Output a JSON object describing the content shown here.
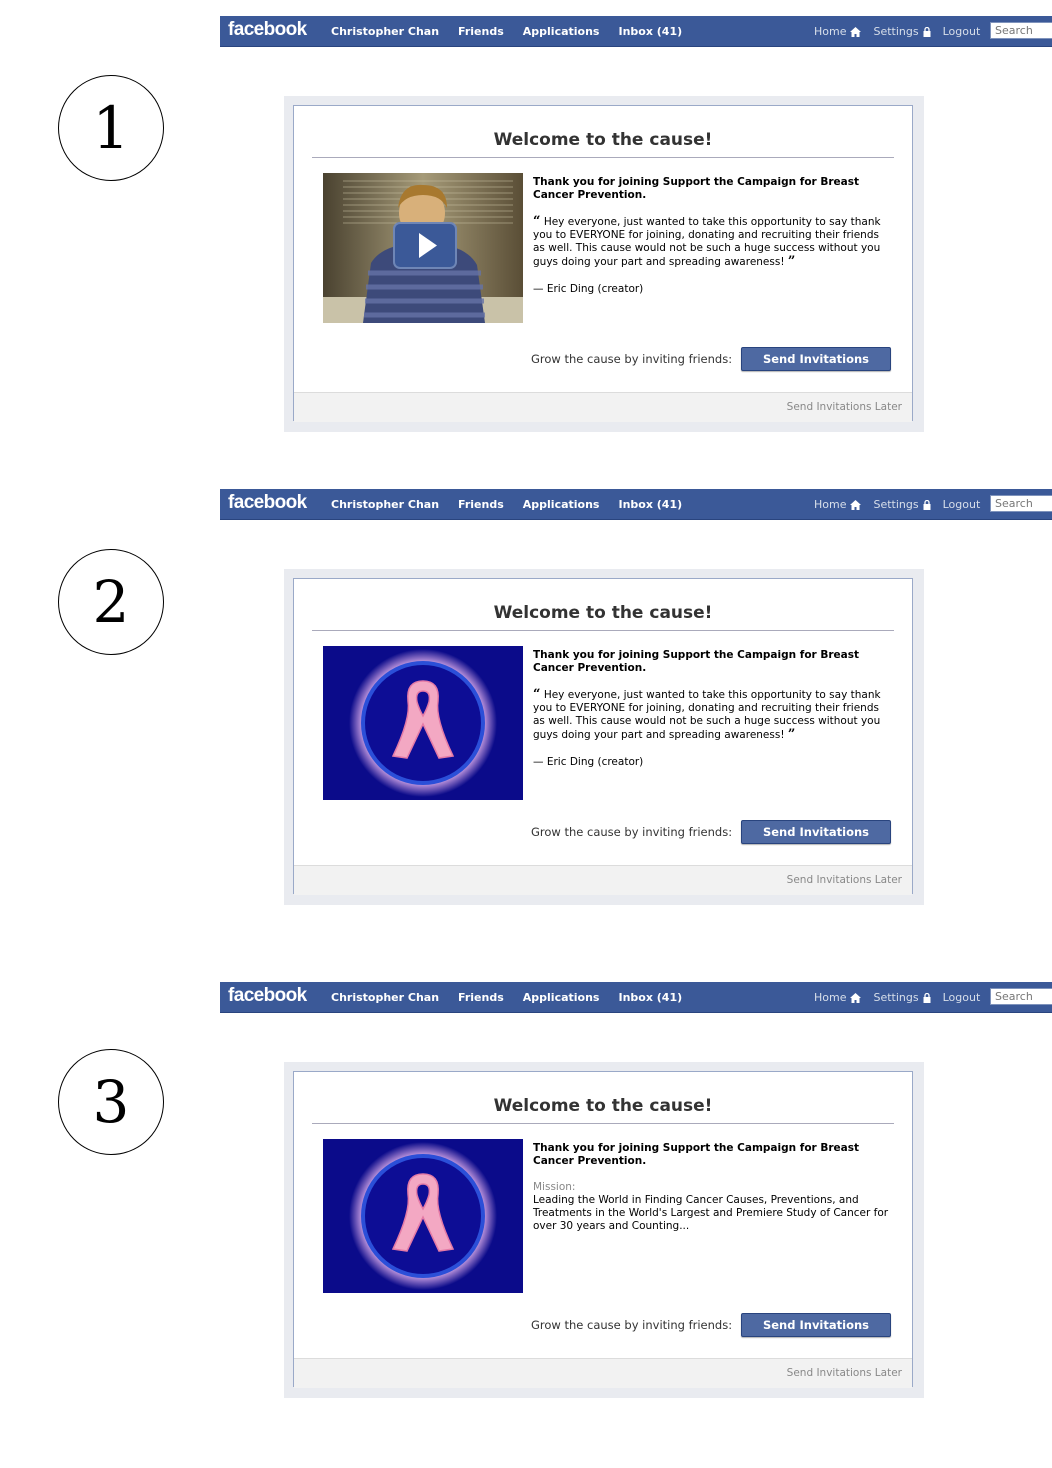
{
  "colors": {
    "facebook_blue": "#3b5998",
    "button_blue": "#4e69a2",
    "ribbon_bg": "#0b0b8a",
    "ribbon_pink": "#f3a8c3"
  },
  "topbar": {
    "logo": "facebook",
    "nav": [
      "Christopher Chan",
      "Friends",
      "Applications",
      "Inbox (41)"
    ],
    "right": {
      "home": "Home",
      "settings": "Settings",
      "logout": "Logout"
    },
    "search_placeholder": "Search",
    "icons": [
      "home-icon",
      "lock-icon"
    ]
  },
  "steps": [
    "1",
    "2",
    "3"
  ],
  "dialog": {
    "title": "Welcome to the cause!",
    "thanks": "Thank you for joining Support the Campaign for Breast Cancer Prevention.",
    "open_quote": "“",
    "quote": "Hey everyone, just wanted to take this opportunity to say thank you to EVERYONE for joining, donating and recruiting their friends as well. This cause would not be such a huge success without you guys doing your part and spreading awareness!",
    "close_quote": "”",
    "attribution": "—  Eric Ding (creator)",
    "grow_label": "Grow the cause by inviting friends:",
    "send_button": "Send Invitations",
    "later_link": "Send Invitations Later",
    "mission_label": "Mission:",
    "mission_text": "Leading the World in Finding Cancer Causes, Preventions, and Treatments in the World's Largest and Premiere Study of Cancer for over 30 years and Counting..."
  },
  "media": {
    "panel1": "video-thumbnail",
    "panel2": "pink-ribbon-image",
    "panel3": "pink-ribbon-image"
  }
}
